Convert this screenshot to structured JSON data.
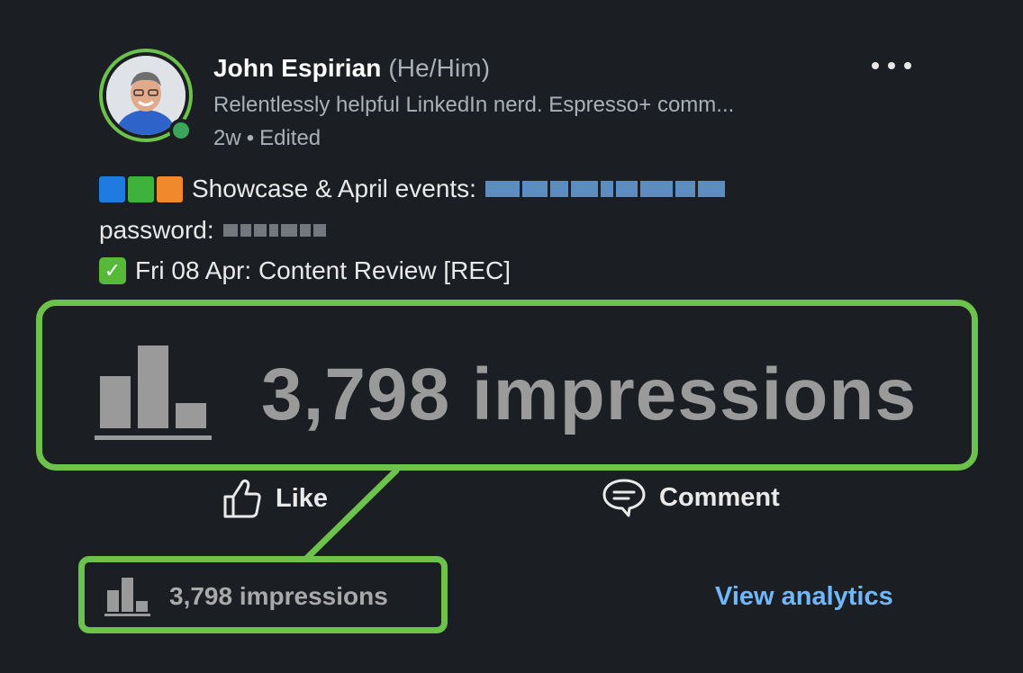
{
  "post": {
    "author_name": "John Espirian",
    "pronouns": "(He/Him)",
    "headline": "Relentlessly helpful LinkedIn nerd. Espresso+ comm...",
    "time": "2w",
    "edited": "Edited",
    "lines": {
      "line1_text": "Showcase & April events:",
      "line2_text": "password:",
      "line3_text": "Fri 08 Apr: Content Review [REC]"
    },
    "emoji_square_colors": [
      "#1f7be0",
      "#3fb13d",
      "#f0892b"
    ],
    "check_emoji": "✓"
  },
  "callout": {
    "impressions_large": "3,798 impressions",
    "accent_color": "#6cc24a"
  },
  "actions": {
    "like_label": "Like",
    "comment_label": "Comment"
  },
  "footer": {
    "impressions": "3,798 impressions",
    "view_analytics": "View analytics",
    "link_color": "#71b7fb"
  },
  "icons": {
    "bar_chart": "bar-chart-icon",
    "thumbs_up": "thumbs-up-icon",
    "comment": "comment-icon",
    "more": "more-icon"
  }
}
